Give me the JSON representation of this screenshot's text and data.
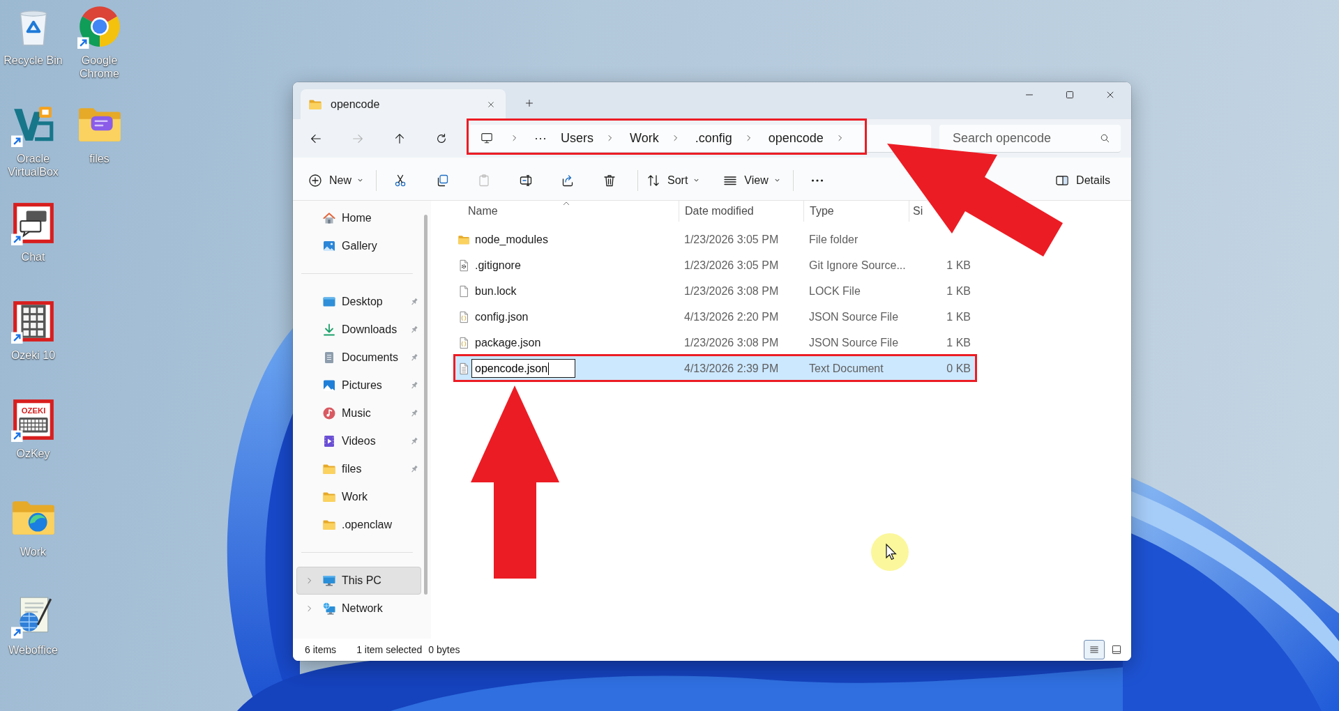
{
  "desktop": {
    "icon_columns": [
      [
        {
          "label": "Recycle Bin",
          "kind": "bin",
          "shortcut": false
        },
        {
          "label": "Oracle VirtualBox",
          "kind": "virtualbox",
          "shortcut": true
        },
        {
          "label": "Chat",
          "kind": "chat",
          "shortcut": true
        },
        {
          "label": "Ozeki 10",
          "kind": "keypad",
          "shortcut": true
        },
        {
          "label": "OzKey",
          "kind": "keyboard",
          "shortcut": true,
          "logo_text": "OZEKI"
        },
        {
          "label": "Work",
          "kind": "swirlfolder",
          "shortcut": false
        },
        {
          "label": "Weboffice",
          "kind": "webdoc",
          "shortcut": true
        }
      ],
      [
        {
          "label": "Google Chrome",
          "kind": "browser",
          "shortcut": true
        },
        {
          "label": "files",
          "kind": "chatfolder",
          "shortcut": false
        }
      ]
    ]
  },
  "window": {
    "tabs": [
      {
        "title": "opencode",
        "selected": true
      }
    ],
    "nav_buttons": [
      {
        "kind": "back",
        "disabled": false
      },
      {
        "kind": "forward",
        "disabled": true
      },
      {
        "kind": "up",
        "disabled": false
      },
      {
        "kind": "refresh",
        "disabled": false
      }
    ],
    "address_bar": {
      "overflow": "···",
      "crumbs": [
        "Users",
        "Work",
        ".config",
        "opencode"
      ],
      "annotated": true
    },
    "search": {
      "placeholder": "Search opencode"
    },
    "toolbar": {
      "items": [
        {
          "kind": "new",
          "label": "New",
          "dropdown": true
        },
        {
          "kind": "separator"
        },
        {
          "kind": "cut",
          "disabled": false
        },
        {
          "kind": "copy",
          "disabled": false
        },
        {
          "kind": "paste",
          "disabled": true
        },
        {
          "kind": "rename",
          "disabled": false
        },
        {
          "kind": "share",
          "disabled": false
        },
        {
          "kind": "delete",
          "disabled": false
        },
        {
          "kind": "separator"
        },
        {
          "kind": "sort",
          "label": "Sort",
          "dropdown": true
        },
        {
          "kind": "view",
          "label": "View",
          "dropdown": true
        },
        {
          "kind": "separator"
        },
        {
          "kind": "more",
          "disabled": false
        }
      ],
      "right": [
        {
          "kind": "details",
          "label": "Details"
        }
      ]
    },
    "sidebar": {
      "groups": [
        [
          {
            "label": "Home",
            "kind": "home",
            "selected": false
          },
          {
            "label": "Gallery",
            "kind": "gallery",
            "selected": false
          }
        ],
        [
          {
            "label": "Desktop",
            "kind": "desktop",
            "pinned": true,
            "selected": false
          },
          {
            "label": "Downloads",
            "kind": "downloads",
            "pinned": true,
            "selected": false
          },
          {
            "label": "Documents",
            "kind": "documents",
            "pinned": true,
            "selected": false
          },
          {
            "label": "Pictures",
            "kind": "pictures",
            "pinned": true,
            "selected": false
          },
          {
            "label": "Music",
            "kind": "music",
            "pinned": true,
            "selected": false
          },
          {
            "label": "Videos",
            "kind": "videos",
            "pinned": true,
            "selected": false
          },
          {
            "label": "files",
            "kind": "folder",
            "pinned": true,
            "selected": false
          },
          {
            "label": "Work",
            "kind": "folder",
            "pinned": false,
            "selected": false
          },
          {
            "label": ".openclaw",
            "kind": "folder",
            "pinned": false,
            "selected": false
          }
        ],
        [
          {
            "label": "This PC",
            "kind": "pc",
            "expanded": false,
            "selected": true
          },
          {
            "label": "Network",
            "kind": "network",
            "expanded": false,
            "selected": false
          }
        ]
      ]
    },
    "file_list": {
      "columns": [
        {
          "label": "Name",
          "sort_ascending": true
        },
        {
          "label": "Date modified"
        },
        {
          "label": "Type"
        },
        {
          "label": "Si"
        }
      ],
      "rows": [
        {
          "kind": "folder",
          "name": "node_modules",
          "date": "1/23/2026 3:05 PM",
          "type": "File folder",
          "selected": false,
          "renaming": false,
          "annotated": false
        },
        {
          "kind": "gitignore",
          "name": ".gitignore",
          "date": "1/23/2026 3:05 PM",
          "type": "Git Ignore Source...",
          "size": "1 KB",
          "selected": false,
          "renaming": false,
          "annotated": false
        },
        {
          "kind": "lock",
          "name": "bun.lock",
          "date": "1/23/2026 3:08 PM",
          "type": "LOCK File",
          "size": "1 KB",
          "selected": false,
          "renaming": false,
          "annotated": false
        },
        {
          "kind": "json",
          "name": "config.json",
          "date": "4/13/2026 2:20 PM",
          "type": "JSON Source File",
          "size": "1 KB",
          "selected": false,
          "renaming": false,
          "annotated": false
        },
        {
          "kind": "json",
          "name": "package.json",
          "date": "1/23/2026 3:08 PM",
          "type": "JSON Source File",
          "size": "1 KB",
          "selected": false,
          "renaming": false,
          "annotated": false
        },
        {
          "kind": "text",
          "name": "opencode.json",
          "date": "4/13/2026 2:39 PM",
          "type": "Text Document",
          "size": "0 KB",
          "selected": true,
          "renaming": true,
          "annotated": true
        }
      ]
    },
    "status_bar": {
      "item_count": "6 items",
      "selection": "1 item selected",
      "selection_size": "0 bytes",
      "views": [
        {
          "kind": "details",
          "selected": true
        },
        {
          "kind": "tiles",
          "selected": false
        }
      ]
    }
  }
}
